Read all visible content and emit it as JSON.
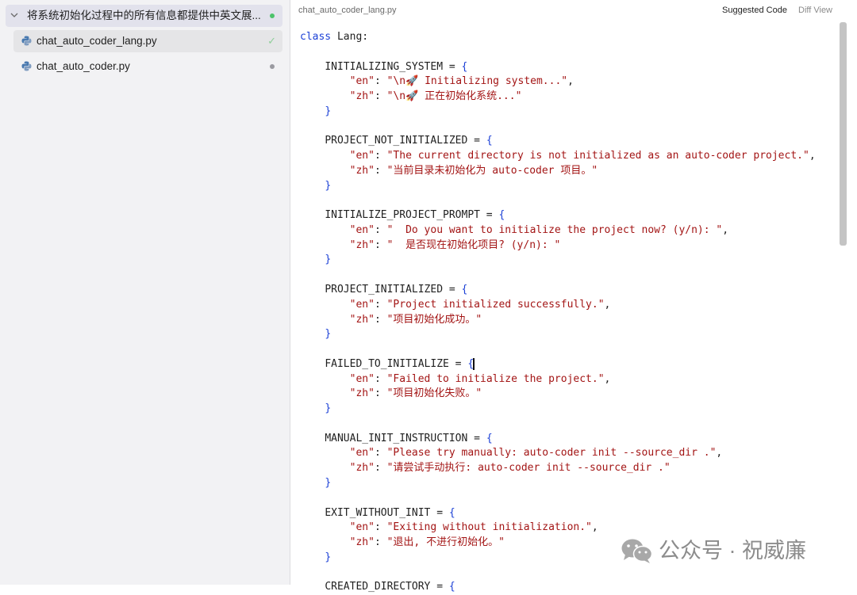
{
  "sidebar": {
    "group": {
      "title": "将系统初始化过程中的所有信息都提供中英文展..."
    },
    "files": [
      {
        "label": "chat_auto_coder_lang.py",
        "status": "✓"
      },
      {
        "label": "chat_auto_coder.py"
      }
    ]
  },
  "editor": {
    "filename": "chat_auto_coder_lang.py",
    "suggested_code": "Suggested Code",
    "diff_view": "Diff View",
    "code": {
      "class_keyword": "class",
      "class_name": " Lang:",
      "blocks": [
        {
          "name": "INITIALIZING_SYSTEM",
          "en_value": "\"\\n🚀 Initializing system...\"",
          "zh_value": "\"\\n🚀 正在初始化系统...\""
        },
        {
          "name": "PROJECT_NOT_INITIALIZED",
          "en_value": "\"The current directory is not initialized as an auto-coder project.\"",
          "zh_value": "\"当前目录未初始化为 auto-coder 项目。\""
        },
        {
          "name": "INITIALIZE_PROJECT_PROMPT",
          "en_value": "\"  Do you want to initialize the project now? (y/n): \"",
          "zh_value": "\"  是否现在初始化项目? (y/n): \""
        },
        {
          "name": "PROJECT_INITIALIZED",
          "en_value": "\"Project initialized successfully.\"",
          "zh_value": "\"项目初始化成功。\""
        },
        {
          "name": "FAILED_TO_INITIALIZE",
          "en_value": "\"Failed to initialize the project.\"",
          "zh_value": "\"项目初始化失败。\""
        },
        {
          "name": "MANUAL_INIT_INSTRUCTION",
          "en_value": "\"Please try manually: auto-coder init --source_dir .\"",
          "zh_value": "\"请尝试手动执行: auto-coder init --source_dir .\""
        },
        {
          "name": "EXIT_WITHOUT_INIT",
          "en_value": "\"Exiting without initialization.\"",
          "zh_value": "\"退出, 不进行初始化。\""
        },
        {
          "name": "CREATED_DIRECTORY"
        }
      ],
      "en_key": "\"en\"",
      "zh_key": "\"zh\"",
      "assign": " = ",
      "open_brace": "{",
      "close_brace": "}",
      "colon": ": ",
      "comma": ","
    }
  },
  "watermark": {
    "text": "公众号 · 祝威廉"
  },
  "colors": {
    "keyword": "#1a3fd6",
    "string": "#a31515",
    "sidebar_bg": "#f2f2f4",
    "status_green": "#4cc36a"
  }
}
